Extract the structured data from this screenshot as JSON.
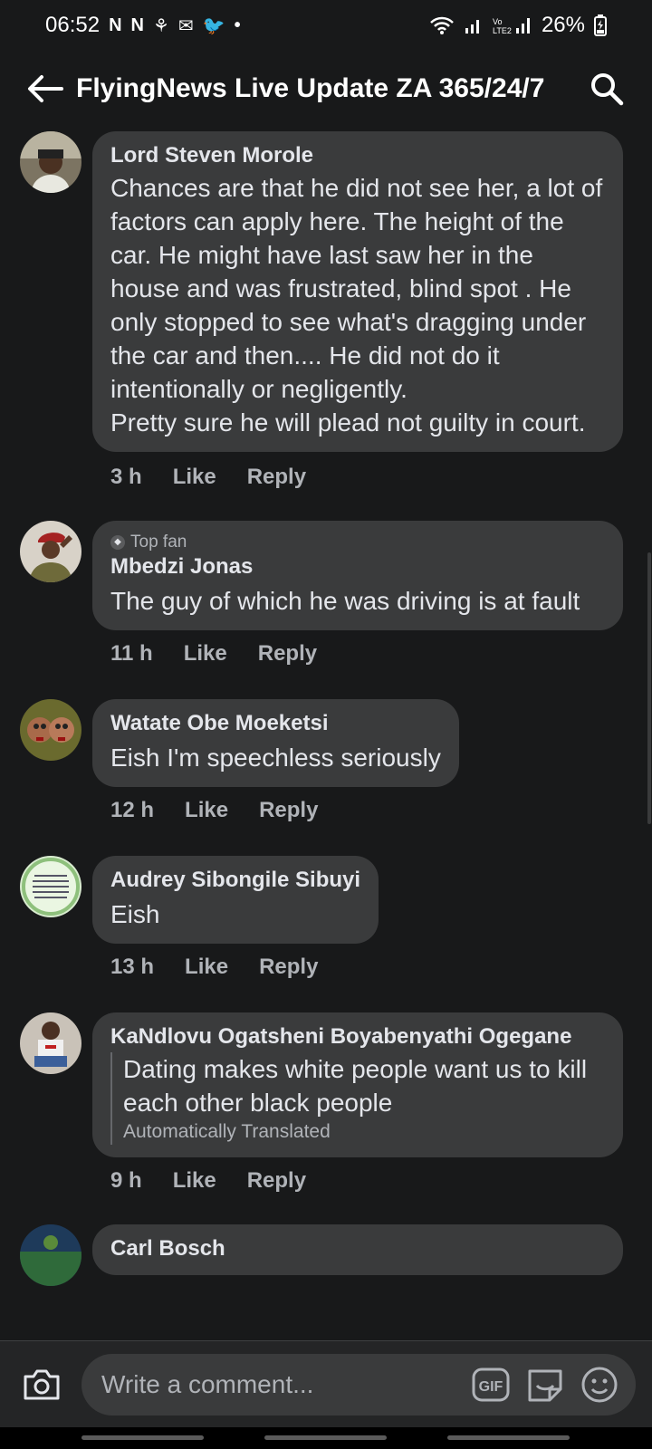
{
  "status_bar": {
    "time": "06:52",
    "notif_icons": [
      "N",
      "N",
      "⚘",
      "✉",
      "🐦",
      "•"
    ],
    "battery": "26%"
  },
  "header": {
    "title": "FlyingNews Live Update ZA 365/24/7",
    "back_icon": "arrow-left-icon",
    "search_icon": "search-icon"
  },
  "comments": [
    {
      "author": "Lord Steven Morole",
      "text": "Chances are that he did not see her, a lot of factors can apply here. The height of the car. He might have last saw her in the house and was frustrated, blind spot . He only stopped to see what's dragging under the car and then.... He did not do it intentionally or negligently.\nPretty sure he will plead not guilty in court.",
      "time": "3 h",
      "like": "Like",
      "reply": "Reply"
    },
    {
      "badge": "Top fan",
      "author": "Mbedzi Jonas",
      "text": "The guy of which he was driving is at fault",
      "time": "11 h",
      "like": "Like",
      "reply": "Reply"
    },
    {
      "author": "Watate Obe Moeketsi",
      "text": "Eish I'm speechless seriously",
      "time": "12 h",
      "like": "Like",
      "reply": "Reply"
    },
    {
      "author": "Audrey Sibongile Sibuyi",
      "text": "Eish",
      "time": "13 h",
      "like": "Like",
      "reply": "Reply"
    },
    {
      "author": "KaNdlovu Ogatsheni Boyabenyathi Ogegane",
      "text": "Dating makes white people want us to kill each other black people",
      "translated": "Automatically Translated",
      "time": "9 h",
      "like": "Like",
      "reply": "Reply"
    },
    {
      "author": "Carl Bosch"
    }
  ],
  "composer": {
    "placeholder": "Write a comment...",
    "gif_label": "GIF"
  }
}
